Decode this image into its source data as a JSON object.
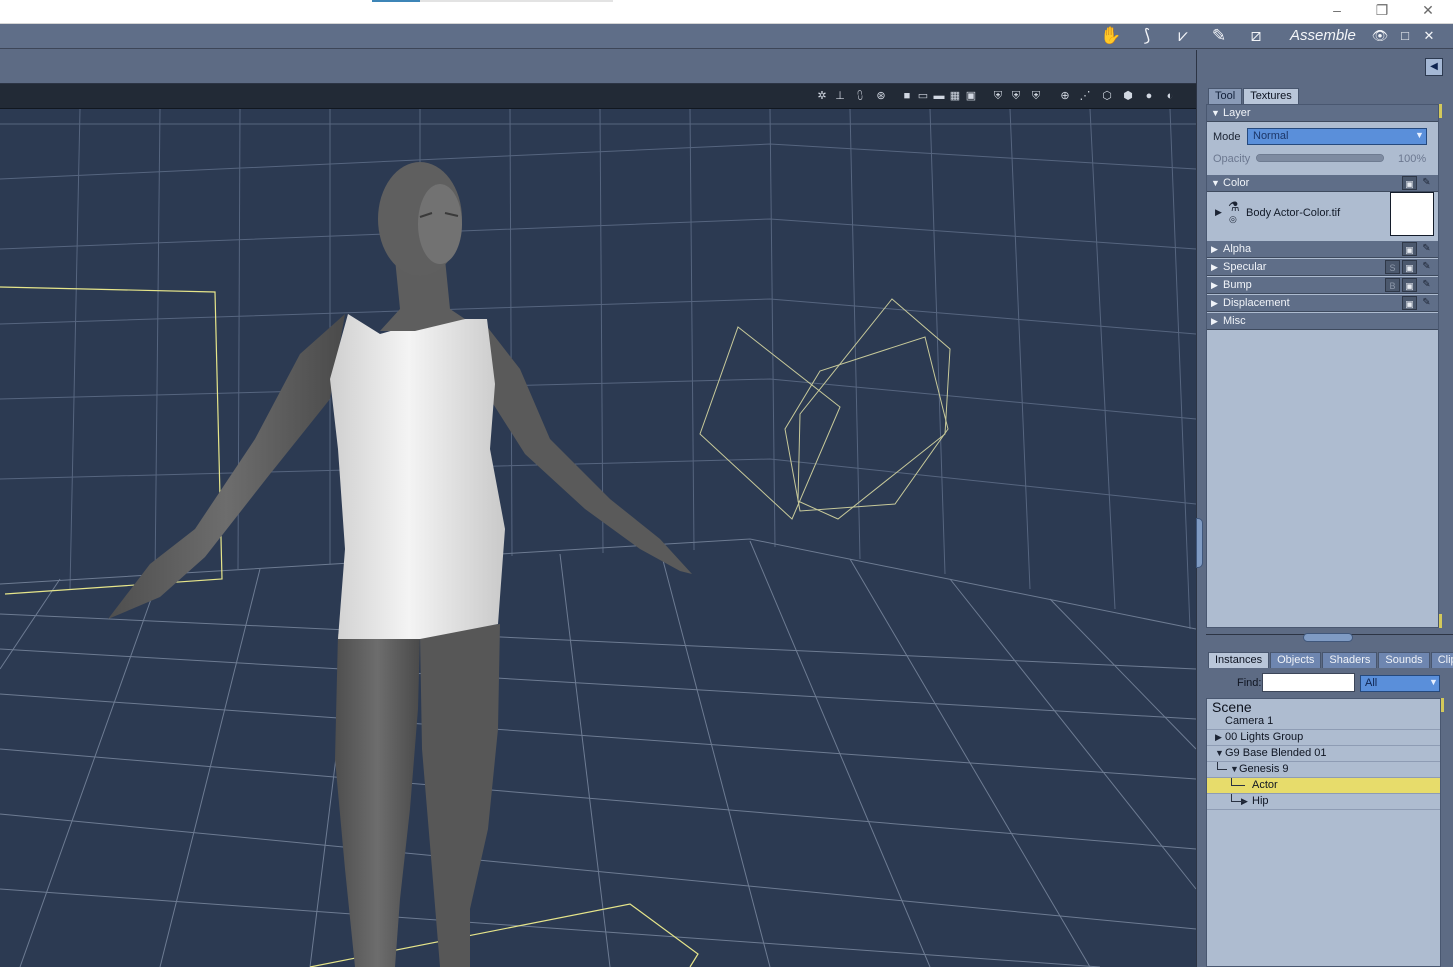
{
  "window": {
    "progress_fraction": 0.2,
    "controls": [
      "–",
      "❐",
      "✕"
    ]
  },
  "rooms": {
    "label": "Assemble",
    "icons": [
      "hand-pose-icon",
      "feather-icon",
      "bones-icon",
      "brush-icon",
      "ruler-icon"
    ],
    "buttons": [
      "👁",
      "□",
      "✕"
    ]
  },
  "viewport_toolbar": {
    "icons": [
      "✲",
      "⊥",
      "⩇",
      "⊛",
      "■",
      "▭",
      "▬",
      "▦",
      "▣",
      "⛨",
      "⛨",
      "⛨",
      "⊕",
      "⋰",
      "⬡",
      "⬢",
      "●",
      "◐"
    ]
  },
  "textures_panel": {
    "tabs": [
      {
        "label": "Tool",
        "active": false
      },
      {
        "label": "Textures",
        "active": true
      }
    ],
    "layer": {
      "title": "Layer",
      "mode_label": "Mode",
      "mode_value": "Normal",
      "opacity_label": "Opacity",
      "opacity_value": "100%",
      "opacity_fraction": 1.0
    },
    "color": {
      "title": "Color",
      "texture_name": "Body Actor-Color.tif",
      "swatch": "#ffffff"
    },
    "sections": [
      {
        "title": "Alpha",
        "badge": ""
      },
      {
        "title": "Specular",
        "badge": "S"
      },
      {
        "title": "Bump",
        "badge": "B"
      },
      {
        "title": "Displacement",
        "badge": ""
      },
      {
        "title": "Misc",
        "badge": ""
      }
    ]
  },
  "hierarchy": {
    "tabs": [
      {
        "label": "Instances",
        "active": true
      },
      {
        "label": "Objects",
        "active": false
      },
      {
        "label": "Shaders",
        "active": false
      },
      {
        "label": "Sounds",
        "active": false
      },
      {
        "label": "Clips",
        "active": false
      }
    ],
    "find_label": "Find:",
    "find_value": "",
    "filter_value": "All",
    "scene_title": "Scene",
    "items": [
      {
        "label": "Camera 1",
        "expander": "",
        "selected": false
      },
      {
        "label": "00 Lights Group",
        "expander": "▶",
        "selected": false
      },
      {
        "label": "G9 Base Blended 01",
        "expander": "▼",
        "selected": false
      },
      {
        "label": "Genesis 9",
        "expander": "▼",
        "selected": false
      },
      {
        "label": "Actor",
        "expander": "",
        "selected": true
      },
      {
        "label": "Hip",
        "expander": "▶",
        "selected": false
      }
    ]
  },
  "colors": {
    "viewport_bg": "#2c3a52",
    "grid": "#6d7b92",
    "selection_outline": "#e6e58a",
    "selected_row": "#e7dc6b"
  }
}
